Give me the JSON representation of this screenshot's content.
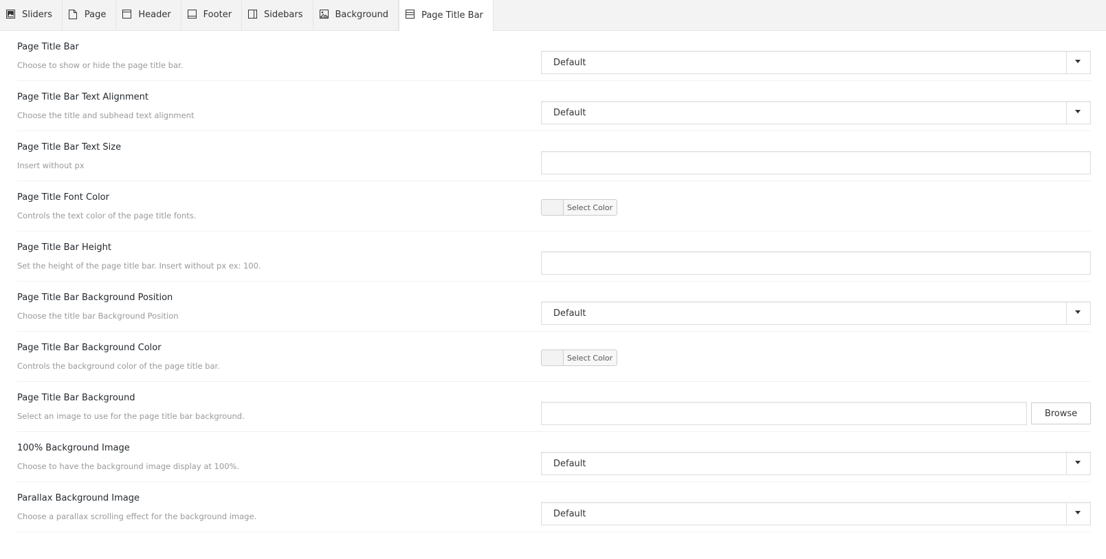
{
  "tabs": [
    {
      "label": "Sliders",
      "icon": "image-icon"
    },
    {
      "label": "Page",
      "icon": "page-icon"
    },
    {
      "label": "Header",
      "icon": "header-icon"
    },
    {
      "label": "Footer",
      "icon": "footer-icon"
    },
    {
      "label": "Sidebars",
      "icon": "sidebars-icon"
    },
    {
      "label": "Background",
      "icon": "background-icon"
    },
    {
      "label": "Page Title Bar",
      "icon": "title-bar-icon",
      "active": true
    }
  ],
  "settings": [
    {
      "title": "Page Title Bar",
      "desc": "Choose to show or hide the page title bar.",
      "control": "select",
      "value": "Default"
    },
    {
      "title": "Page Title Bar Text Alignment",
      "desc": "Choose the title and subhead text alignment",
      "control": "select",
      "value": "Default"
    },
    {
      "title": "Page Title Bar Text Size",
      "desc": "Insert without px",
      "control": "text",
      "value": ""
    },
    {
      "title": "Page Title Font Color",
      "desc": "Controls the text color of the page title fonts.",
      "control": "color",
      "button_label": "Select Color"
    },
    {
      "title": "Page Title Bar Height",
      "desc": "Set the height of the page title bar. Insert without px ex: 100.",
      "control": "text",
      "value": ""
    },
    {
      "title": "Page Title Bar Background Position",
      "desc": "Choose the title bar Background Position",
      "control": "select",
      "value": "Default"
    },
    {
      "title": "Page Title Bar Background Color",
      "desc": "Controls the background color of the page title bar.",
      "control": "color",
      "button_label": "Select Color"
    },
    {
      "title": "Page Title Bar Background",
      "desc": "Select an image to use for the page title bar background.",
      "control": "file",
      "value": "",
      "button_label": "Browse"
    },
    {
      "title": "100% Background Image",
      "desc": "Choose to have the background image display at 100%.",
      "control": "select",
      "value": "Default"
    },
    {
      "title": "Parallax Background Image",
      "desc": "Choose a parallax scrolling effect for the background image.",
      "control": "select",
      "value": "Default"
    }
  ]
}
